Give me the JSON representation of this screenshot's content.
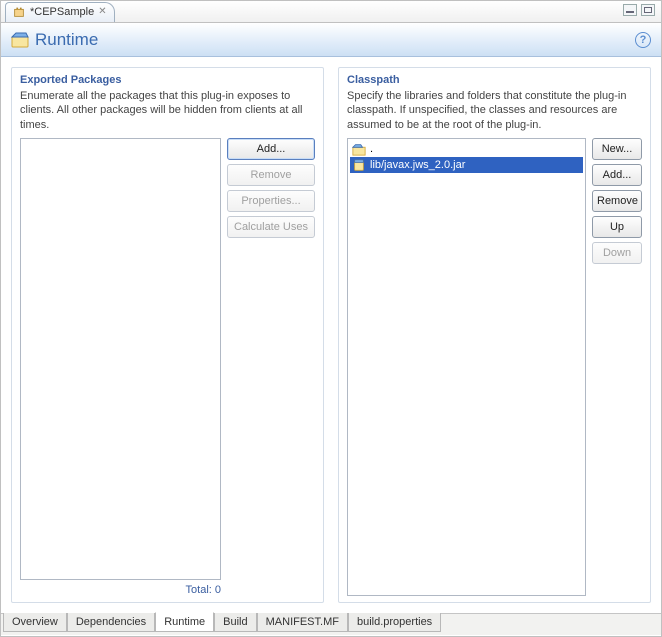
{
  "tab": {
    "title": "*CEPSample"
  },
  "page": {
    "title": "Runtime"
  },
  "exported": {
    "title": "Exported Packages",
    "desc": "Enumerate all the packages that this plug-in exposes to clients. All other packages will be hidden from clients at all times.",
    "buttons": {
      "add": "Add...",
      "remove": "Remove",
      "properties": "Properties...",
      "calculate": "Calculate Uses"
    },
    "total_label": "Total: 0"
  },
  "classpath": {
    "title": "Classpath",
    "desc": "Specify the libraries and folders that constitute the plug-in classpath.  If unspecified, the classes and resources are assumed to be at the root of the plug-in.",
    "items": [
      {
        "label": ".",
        "icon": "root"
      },
      {
        "label": "lib/javax.jws_2.0.jar",
        "icon": "jar",
        "selected": true
      }
    ],
    "buttons": {
      "new": "New...",
      "add": "Add...",
      "remove": "Remove",
      "up": "Up",
      "down": "Down"
    }
  },
  "bottom_tabs": [
    "Overview",
    "Dependencies",
    "Runtime",
    "Build",
    "MANIFEST.MF",
    "build.properties"
  ],
  "active_bottom_tab": "Runtime"
}
